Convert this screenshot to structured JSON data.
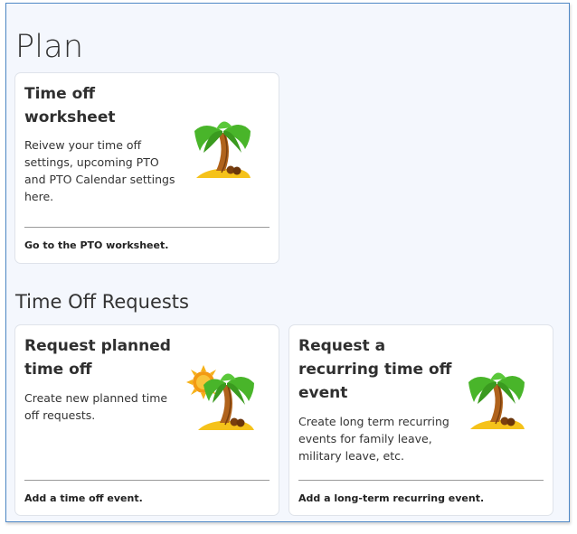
{
  "page": {
    "title": "Plan"
  },
  "worksheet_card": {
    "title_line1": "Time off",
    "title_line2": "worksheet",
    "desc_line1": "Reivew your time off",
    "desc_line2": "settings, upcoming PTO",
    "desc_line3": "and PTO Calendar settings",
    "desc_line4": "here.",
    "link": "Go to the PTO worksheet.",
    "icon": "palm-tree-icon"
  },
  "requests_section": {
    "title": "Time Off Requests"
  },
  "planned_card": {
    "title_line1": "Request planned",
    "title_line2": "time off",
    "desc_line1": "Create new planned time",
    "desc_line2": "off requests.",
    "link": "Add a time off event.",
    "icon": "palm-tree-sun-icon"
  },
  "recurring_card": {
    "title_line1": "Request a",
    "title_line2": "recurring time off",
    "title_line3": "event",
    "desc_line1": "Create long term recurring",
    "desc_line2": "events for family leave,",
    "desc_line3": "military leave, etc.",
    "link": "Add a long-term recurring event.",
    "icon": "palm-tree-icon"
  },
  "colors": {
    "frame_border": "#4f88c6",
    "background": "#f4f7fd",
    "card_background": "#ffffff",
    "palm_leaf": "#49b52a",
    "palm_trunk": "#b0631c",
    "sand": "#f5c21a",
    "sun": "#f39a12"
  }
}
